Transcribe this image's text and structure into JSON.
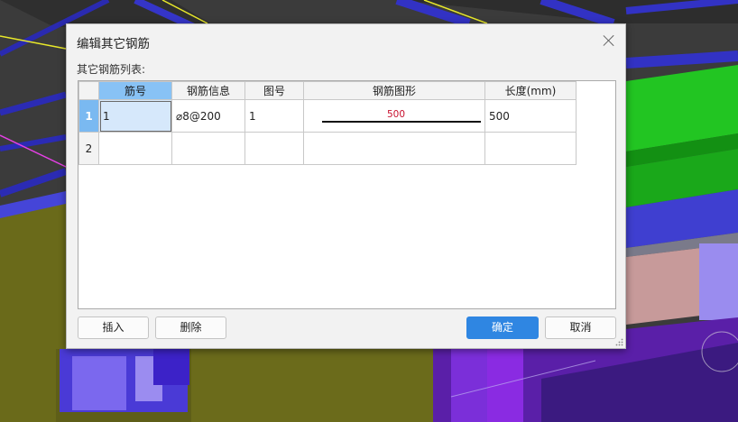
{
  "dialog": {
    "title": "编辑其它钢筋",
    "list_label": "其它钢筋列表:",
    "close_icon": "close-icon"
  },
  "grid": {
    "columns": [
      "筋号",
      "钢筋信息",
      "图号",
      "钢筋图形",
      "长度(mm)"
    ],
    "selected_column": 0,
    "selected_row": 0,
    "rows": [
      {
        "row_number": "1",
        "bar_no": "1",
        "rebar_info": "⌀8@200",
        "figure_no": "1",
        "shape_dimension": "500",
        "length": "500"
      },
      {
        "row_number": "2",
        "bar_no": "",
        "rebar_info": "",
        "figure_no": "",
        "shape_dimension": "",
        "length": ""
      }
    ]
  },
  "buttons": {
    "insert": "插入",
    "delete": "删除",
    "ok": "确定",
    "cancel": "取消"
  },
  "colors": {
    "primary_button": "#2f86e2",
    "selected_header": "#88c2f5",
    "active_cell": "#d6e8fb",
    "shape_dimension": "#c8102e"
  }
}
